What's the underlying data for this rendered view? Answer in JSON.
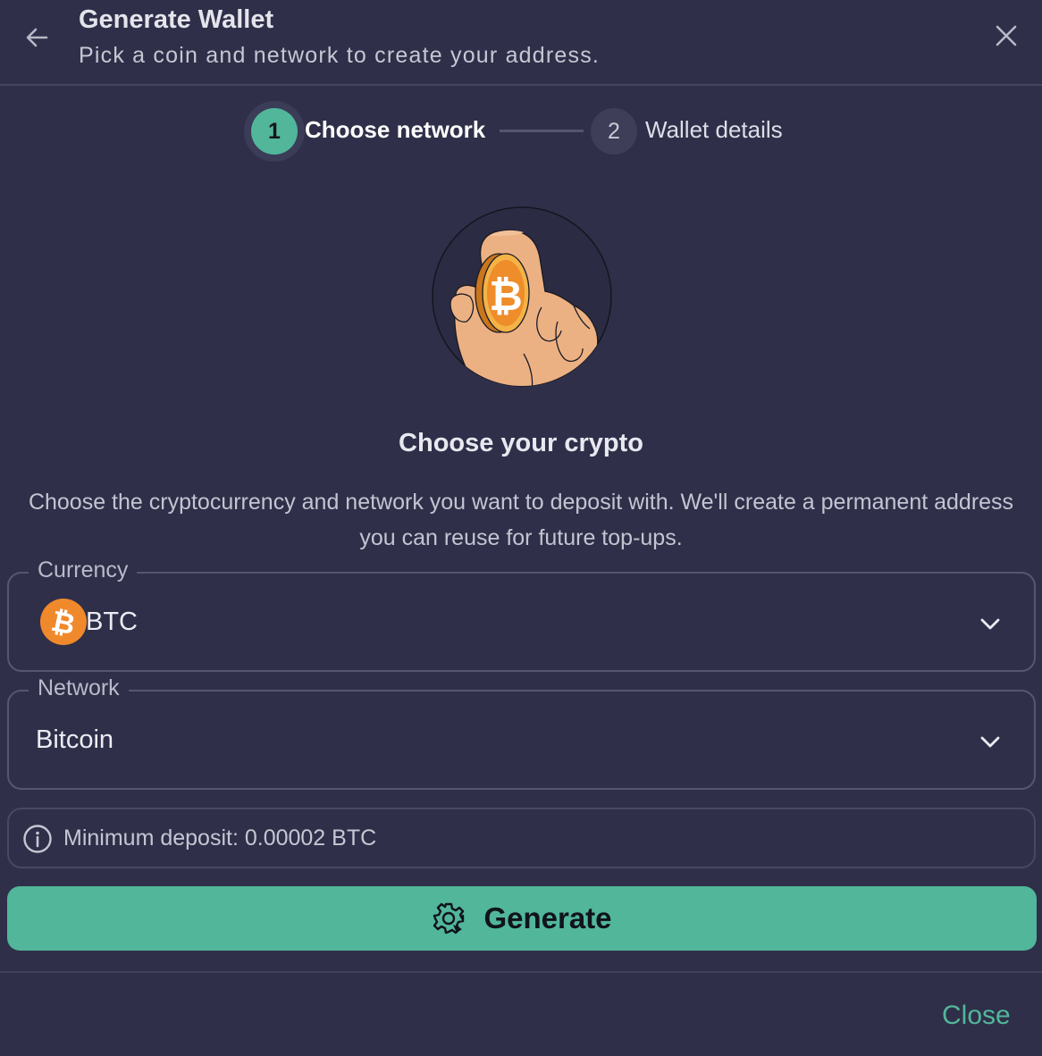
{
  "header": {
    "title": "Generate Wallet",
    "subtitle": "Pick a coin and network to create your address.",
    "back_icon": "arrow-left-icon",
    "close_icon": "close-icon"
  },
  "stepper": {
    "steps": [
      {
        "number": "1",
        "label": "Choose network",
        "state": "active"
      },
      {
        "number": "2",
        "label": "Wallet details",
        "state": "upcoming"
      }
    ]
  },
  "content": {
    "title": "Choose your crypto",
    "description": "Choose the cryptocurrency and network you want to deposit with. We'll create a permanent address you can reuse for future top-ups."
  },
  "form": {
    "currency": {
      "label": "Currency",
      "value": "BTC",
      "icon": "bitcoin-icon"
    },
    "network": {
      "label": "Network",
      "value": "Bitcoin"
    }
  },
  "info": {
    "text": "Minimum deposit: 0.00002 BTC",
    "icon": "info-icon"
  },
  "actions": {
    "generate_label": "Generate",
    "generate_icon": "gear-icon",
    "close_label": "Close"
  },
  "colors": {
    "background": "#2f2f49",
    "accent": "#52b69a",
    "bitcoin_orange": "#f0892b",
    "border": "#56566f"
  }
}
